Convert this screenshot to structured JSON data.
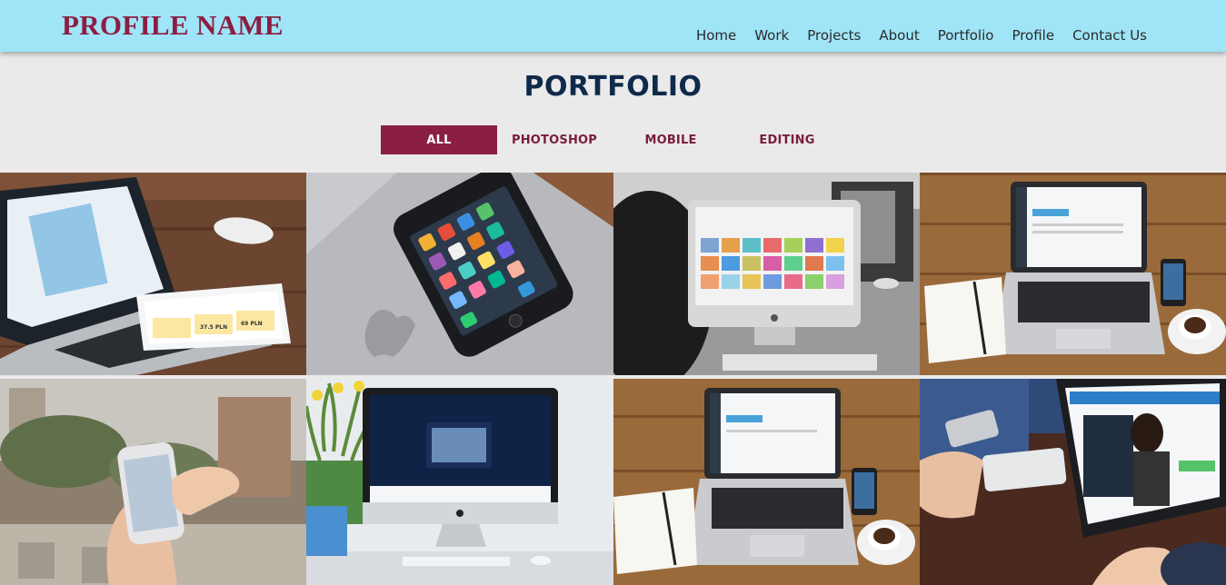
{
  "header": {
    "brand": "PROFILE NAME",
    "nav": [
      "Home",
      "Work",
      "Projects",
      "About",
      "Portfolio",
      "Profile",
      "Contact Us"
    ]
  },
  "section": {
    "title": "PORTFOLIO",
    "filters": [
      "ALL",
      "PHOTOSHOP",
      "MOBILE",
      "EDITING"
    ],
    "active_filter": "ALL"
  },
  "tablet_screen": {
    "prices": [
      "37.5 PLN",
      "69 PLN"
    ]
  },
  "colors": {
    "header_bg": "#9fe4f7",
    "brand": "#8b1e43",
    "accent": "#8b1e43",
    "title": "#0f2a4a",
    "page_bg": "#eaeaea"
  }
}
